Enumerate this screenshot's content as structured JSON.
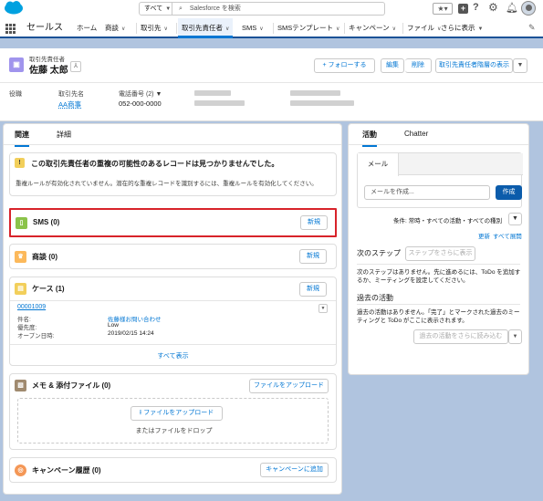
{
  "global_header": {
    "scope": "すべて",
    "search_placeholder": "Salesforce を検索"
  },
  "nav": {
    "app_name": "セールス",
    "tabs": [
      {
        "label": "ホーム"
      },
      {
        "label": "商談"
      },
      {
        "label": "取引先"
      },
      {
        "label": "取引先責任者"
      },
      {
        "label": "SMS"
      },
      {
        "label": "SMSテンプレート"
      },
      {
        "label": "キャンペーン"
      },
      {
        "label": "ファイル"
      },
      {
        "label": "さらに表示"
      }
    ]
  },
  "record": {
    "object_label": "取引先責任者",
    "name": "佐藤 太郎",
    "follow_label": "+ フォローする",
    "edit_label": "編集",
    "delete_label": "削除",
    "hierarchy_label": "取引先責任者階層の表示",
    "fields": {
      "title_label": "役職",
      "account_label": "取引先名",
      "account_value": "AA商事",
      "phone_label": "電話番号 (2)",
      "phone_value": "052-000-0000"
    }
  },
  "left_tabs": {
    "related": "関連",
    "detail": "詳細"
  },
  "duplicate": {
    "title": "この取引先責任者の重複の可能性のあるレコードは見つかりませんでした。",
    "body": "重複ルールが有効化されていません。潜在的な重複レコードを識別するには、重複ルールを有効化してください。"
  },
  "sms": {
    "title": "SMS (0)",
    "new_label": "新規"
  },
  "opportunity": {
    "title": "商談 (0)",
    "new_label": "新規"
  },
  "cases": {
    "title": "ケース (1)",
    "new_label": "新規",
    "case_number": "00001009",
    "subject_label": "件名:",
    "subject_value": "佐藤様お問い合わせ",
    "priority_label": "優先度:",
    "priority_value": "Low",
    "open_label": "オープン日時:",
    "open_value": "2019/02/15 14:24",
    "view_all": "すべて表示"
  },
  "files": {
    "title": "メモ & 添付ファイル (0)",
    "upload_label": "ファイルをアップロード",
    "upload_btn_label": "ファイルをアップロード",
    "drop_label": "またはファイルをドロップ"
  },
  "campaign": {
    "title": "キャンペーン履歴 (0)",
    "add_label": "キャンペーンに追加"
  },
  "activity": {
    "tab_activity": "活動",
    "tab_chatter": "Chatter",
    "mail_tab": "メール",
    "mail_placeholder": "メールを作成...",
    "compose_label": "作成",
    "filter_text": "条件: 常時・すべての活動・すべての種別",
    "refresh": "更新",
    "expand_all": "すべて展開",
    "next_steps": "次のステップ",
    "more_steps": "ステップをさらに表示",
    "next_empty": "次のステップはありません。先に進めるには、ToDo を追加するか、ミーティングを設定してください。",
    "past_title": "過去の活動",
    "past_empty": "過去の活動はありません。「完了」とマークされた過去のミーティングと ToDo がここに表示されます。",
    "load_more": "過去の活動をさらに読み込む"
  },
  "colors": {
    "brand": "#0176d3",
    "nav_accent": "#1b5297",
    "highlight": "#d8232a",
    "sms_icon": "#8bc34a",
    "opportunity_icon": "#fcb95b",
    "case_icon": "#f2cf5b",
    "files_icon": "#a08a6f",
    "campaign_icon": "#f49756",
    "contact_icon": "#a094ed"
  }
}
